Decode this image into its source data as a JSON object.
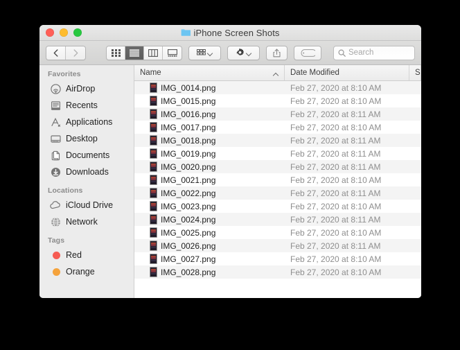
{
  "window": {
    "title": "iPhone Screen Shots",
    "folder_icon": "folder-icon",
    "traffic_lights": {
      "close": "close-button",
      "minimize": "minimize-button",
      "maximize": "maximize-button"
    }
  },
  "toolbar": {
    "back_label": "‹",
    "forward_label": "›",
    "view_modes": [
      {
        "name": "icon-view",
        "active": false
      },
      {
        "name": "list-view",
        "active": true
      },
      {
        "name": "column-view",
        "active": false
      },
      {
        "name": "gallery-view",
        "active": false
      }
    ],
    "group_button": "group-by-button",
    "action_button": "action-gear-button",
    "share_button": "share-button",
    "tag_button": "tag-button"
  },
  "search": {
    "placeholder": "Search",
    "value": ""
  },
  "sidebar": {
    "groups": [
      {
        "header": "Favorites",
        "items": [
          {
            "label": "AirDrop",
            "icon": "airdrop-icon"
          },
          {
            "label": "Recents",
            "icon": "recents-icon"
          },
          {
            "label": "Applications",
            "icon": "applications-icon"
          },
          {
            "label": "Desktop",
            "icon": "desktop-icon"
          },
          {
            "label": "Documents",
            "icon": "documents-icon"
          },
          {
            "label": "Downloads",
            "icon": "downloads-icon"
          }
        ]
      },
      {
        "header": "Locations",
        "items": [
          {
            "label": "iCloud Drive",
            "icon": "icloud-icon"
          },
          {
            "label": "Network",
            "icon": "network-icon"
          }
        ]
      },
      {
        "header": "Tags",
        "items": [
          {
            "label": "Red",
            "icon": "tag-dot",
            "color": "#f65b52"
          },
          {
            "label": "Orange",
            "icon": "tag-dot",
            "color": "#f5a33c"
          }
        ]
      }
    ]
  },
  "filelist": {
    "columns": [
      {
        "key": "name",
        "label": "Name",
        "sorted": "ascending"
      },
      {
        "key": "date",
        "label": "Date Modified",
        "sorted": "none"
      },
      {
        "key": "size",
        "label": "S",
        "sorted": "none"
      }
    ],
    "rows": [
      {
        "name": "IMG_0014.png",
        "date": "Feb 27, 2020 at 8:10 AM",
        "size": ""
      },
      {
        "name": "IMG_0015.png",
        "date": "Feb 27, 2020 at 8:10 AM",
        "size": ""
      },
      {
        "name": "IMG_0016.png",
        "date": "Feb 27, 2020 at 8:11 AM",
        "size": ""
      },
      {
        "name": "IMG_0017.png",
        "date": "Feb 27, 2020 at 8:10 AM",
        "size": ""
      },
      {
        "name": "IMG_0018.png",
        "date": "Feb 27, 2020 at 8:11 AM",
        "size": ""
      },
      {
        "name": "IMG_0019.png",
        "date": "Feb 27, 2020 at 8:11 AM",
        "size": ""
      },
      {
        "name": "IMG_0020.png",
        "date": "Feb 27, 2020 at 8:11 AM",
        "size": ""
      },
      {
        "name": "IMG_0021.png",
        "date": "Feb 27, 2020 at 8:10 AM",
        "size": ""
      },
      {
        "name": "IMG_0022.png",
        "date": "Feb 27, 2020 at 8:11 AM",
        "size": ""
      },
      {
        "name": "IMG_0023.png",
        "date": "Feb 27, 2020 at 8:10 AM",
        "size": ""
      },
      {
        "name": "IMG_0024.png",
        "date": "Feb 27, 2020 at 8:11 AM",
        "size": ""
      },
      {
        "name": "IMG_0025.png",
        "date": "Feb 27, 2020 at 8:10 AM",
        "size": ""
      },
      {
        "name": "IMG_0026.png",
        "date": "Feb 27, 2020 at 8:11 AM",
        "size": ""
      },
      {
        "name": "IMG_0027.png",
        "date": "Feb 27, 2020 at 8:10 AM",
        "size": ""
      },
      {
        "name": "IMG_0028.png",
        "date": "Feb 27, 2020 at 8:10 AM",
        "size": ""
      }
    ]
  },
  "colors": {
    "close": "#ff5f57",
    "minimize": "#febc2e",
    "maximize": "#28c840",
    "folder": "#6cc5f2",
    "selected_view": "#5d5d5d",
    "tag_red": "#f65b52",
    "tag_orange": "#f5a33c"
  }
}
